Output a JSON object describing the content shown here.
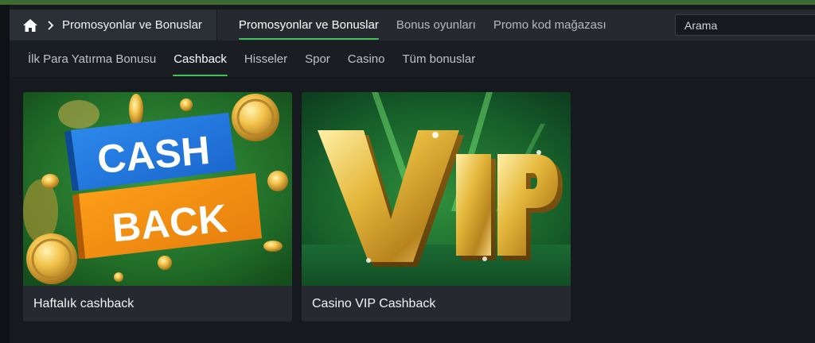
{
  "breadcrumb": {
    "home_icon": "home-icon",
    "separator_icon": "chevron-right-icon",
    "current": "Promosyonlar ve Bonuslar"
  },
  "main_tabs": [
    {
      "label": "Promosyonlar ve Bonuslar",
      "active": true
    },
    {
      "label": "Bonus oyunları",
      "active": false
    },
    {
      "label": "Promo kod mağazası",
      "active": false
    }
  ],
  "search": {
    "placeholder": "Arama",
    "value": ""
  },
  "sub_tabs": [
    {
      "label": "İlk Para Yatırma Bonusu",
      "active": false
    },
    {
      "label": "Cashback",
      "active": true
    },
    {
      "label": "Hisseler",
      "active": false
    },
    {
      "label": "Spor",
      "active": false
    },
    {
      "label": "Casino",
      "active": false
    },
    {
      "label": "Tüm bonuslar",
      "active": false
    }
  ],
  "cards": [
    {
      "title": "Haftalık cashback",
      "banner_lines": [
        "CASH",
        "BACK"
      ]
    },
    {
      "title": "Casino VIP Cashback",
      "banner_text": "VIP"
    }
  ],
  "colors": {
    "accent": "#43c25a",
    "background": "#16191d",
    "header": "#262a30",
    "card": "#262a30"
  }
}
